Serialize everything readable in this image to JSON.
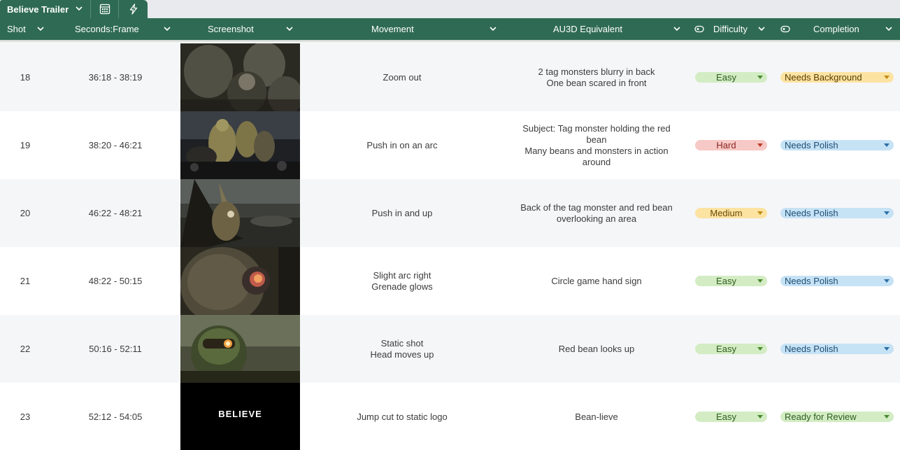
{
  "tabs": {
    "sheet_name": "Believe Trailer",
    "icons": [
      "chevron-down-icon",
      "calculator-icon",
      "lightning-bolt-icon"
    ]
  },
  "columns": {
    "shot": "Shot",
    "seconds_frame": "Seconds:Frame",
    "screenshot": "Screenshot",
    "movement": "Movement",
    "au3d": "AU3D Equivalent",
    "difficulty": "Difficulty",
    "completion": "Completion"
  },
  "colors": {
    "header_green": "#2f6b54",
    "easy": "#d3ecc4",
    "hard": "#f7c9c6",
    "medium": "#fce3a2",
    "needs_background": "#fce3a2",
    "needs_polish": "#c6e2f5",
    "ready_for_review": "#d3ecc4"
  },
  "rows": [
    {
      "shot": "18",
      "time": "36:18 - 38:19",
      "movement": [
        "Zoom out"
      ],
      "au3d": [
        "2 tag monsters blurry in back",
        "One bean scared in front"
      ],
      "difficulty": "Easy",
      "completion": "Needs Background"
    },
    {
      "shot": "19",
      "time": "38:20 - 46:21",
      "movement": [
        "Push in on an arc"
      ],
      "au3d": [
        "Subject: Tag monster holding the red",
        "bean",
        "Many beans and monsters in action",
        "around"
      ],
      "difficulty": "Hard",
      "completion": "Needs Polish"
    },
    {
      "shot": "20",
      "time": "46:22 - 48:21",
      "movement": [
        "Push in and up"
      ],
      "au3d": [
        "Back of the tag monster and red bean",
        "overlooking an area"
      ],
      "difficulty": "Medium",
      "completion": "Needs Polish"
    },
    {
      "shot": "21",
      "time": "48:22 - 50:15",
      "movement": [
        "Slight arc right",
        "Grenade glows"
      ],
      "au3d": [
        "Circle game hand sign"
      ],
      "difficulty": "Easy",
      "completion": "Needs Polish"
    },
    {
      "shot": "22",
      "time": "50:16 - 52:11",
      "movement": [
        "Static shot",
        "Head moves up"
      ],
      "au3d": [
        "Red bean looks up"
      ],
      "difficulty": "Easy",
      "completion": "Needs Polish"
    },
    {
      "shot": "23",
      "time": "52:12 - 54:05",
      "movement": [
        "Jump cut to static logo"
      ],
      "au3d": [
        "Bean-lieve"
      ],
      "difficulty": "Easy",
      "completion": "Ready for Review",
      "logo_text": "BELIEVE"
    }
  ]
}
